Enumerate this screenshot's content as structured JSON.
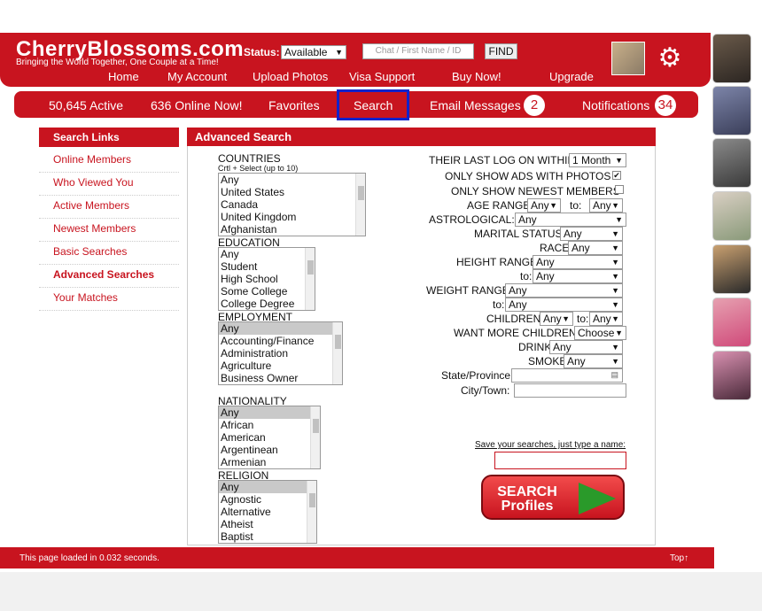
{
  "header": {
    "logo": "CherryBlossoms.com",
    "tagline": "Bringing the World Together, One Couple at a Time!",
    "status_label": "Status:",
    "status_value": "Available",
    "chat_placeholder": "Chat / First Name / ID",
    "find_label": "FIND",
    "nav": [
      "Home",
      "My Account",
      "Upload Photos",
      "Visa Support",
      "Buy Now!",
      "Upgrade"
    ]
  },
  "nav2": {
    "active": "50,645 Active",
    "online": "636 Online Now!",
    "favorites": "Favorites",
    "search": "Search",
    "email": "Email Messages",
    "email_count": "2",
    "notifications": "Notifications",
    "notif_count": "34"
  },
  "sidebar": {
    "title": "Search Links",
    "items": [
      "Online Members",
      "Who Viewed You",
      "Active Members",
      "Newest Members",
      "Basic Searches",
      "Advanced Searches",
      "Your Matches"
    ]
  },
  "panel": {
    "title": "Advanced Search",
    "countries_label": "COUNTRIES",
    "countries_hint": "Crtl + Select (up to 10)",
    "countries": [
      "Any",
      "United States",
      "Canada",
      "United Kingdom",
      "Afghanistan"
    ],
    "education_label": "EDUCATION",
    "education": [
      "Any",
      "Student",
      "High School",
      "Some College",
      "College Degree"
    ],
    "employment_label": "EMPLOYMENT",
    "employment": [
      "Any",
      "Accounting/Finance",
      "Administration",
      "Agriculture",
      "Business Owner"
    ],
    "nationality_label": "NATIONALITY",
    "nationality": [
      "Any",
      "African",
      "American",
      "Argentinean",
      "Armenian"
    ],
    "religion_label": "RELIGION",
    "religion": [
      "Any",
      "Agnostic",
      "Alternative",
      "Atheist",
      "Baptist"
    ],
    "last_log_label": "THEIR LAST LOG ON WITHIN",
    "last_log_value": "1 Month",
    "photos_label": "ONLY SHOW ADS WITH PHOTOS",
    "newest_label": "ONLY SHOW NEWEST MEMBERS",
    "age_label": "AGE RANGE",
    "to": "to:",
    "any": "Any",
    "astro_label": "ASTROLOGICAL:",
    "marital_label": "MARITAL STATUS",
    "race_label": "RACE",
    "height_label": "HEIGHT RANGE",
    "weight_label": "WEIGHT RANGE",
    "children_label": "CHILDREN",
    "want_children_label": "WANT MORE CHILDREN:",
    "want_children_value": "Choose",
    "drink_label": "DRINK",
    "smoke_label": "SMOKE",
    "state_label": "State/Province:",
    "city_label": "City/Town:",
    "save_label": "Save your searches, just type a name:",
    "search_btn_1": "SEARCH",
    "search_btn_2": "Profiles"
  },
  "footer": {
    "load_text": "This page loaded in 0.032 seconds.",
    "top_link": "Top↑"
  },
  "colors": {
    "brand": "#c8141f",
    "highlight": "#1122cc"
  }
}
